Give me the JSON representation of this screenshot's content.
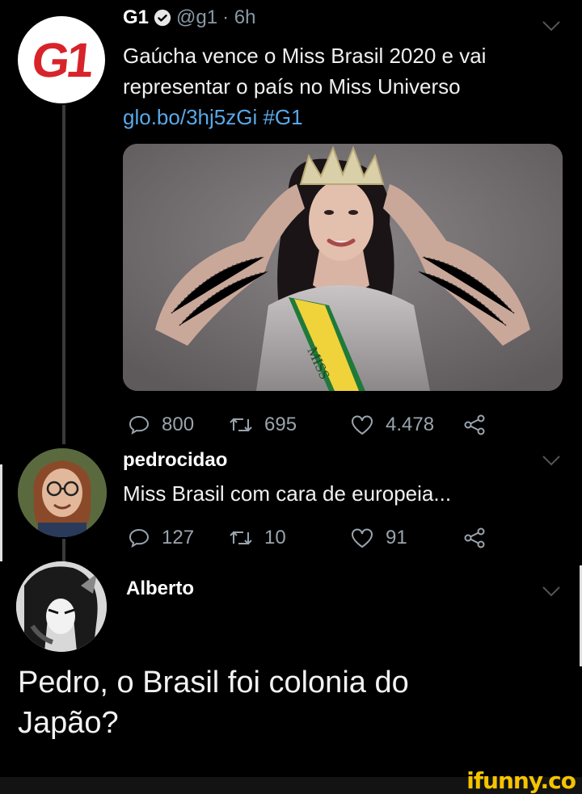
{
  "tweet": {
    "author_name": "G1",
    "author_handle": "@g1",
    "time": "· 6h",
    "text_line1": "Gaúcha vence o Miss Brasil 2020 e vai",
    "text_line2": "representar o país no Miss Universo",
    "link": "glo.bo/3hj5zGi",
    "hashtag": "#G1",
    "avatar_logo": "G1",
    "replies": "800",
    "retweets": "695",
    "likes": "4.478",
    "media_sash_text": "MISS"
  },
  "reply1": {
    "author_name": "pedrocidao",
    "text": "Miss Brasil com cara de europeia...",
    "replies": "127",
    "retweets": "10",
    "likes": "91"
  },
  "reply2": {
    "author_name": "Alberto",
    "text_line1": "Pedro, o Brasil foi colonia do",
    "text_line2": "Japão?"
  },
  "watermark": "ifunny.co",
  "colors": {
    "background": "#000000",
    "link": "#5aa8e8",
    "g1_red": "#d8232a",
    "icon_gray": "#9aa4ad",
    "watermark": "#f5c400"
  },
  "icons": [
    "verified-icon",
    "chevron-down-icon",
    "reply-icon",
    "retweet-icon",
    "like-icon",
    "share-icon"
  ]
}
